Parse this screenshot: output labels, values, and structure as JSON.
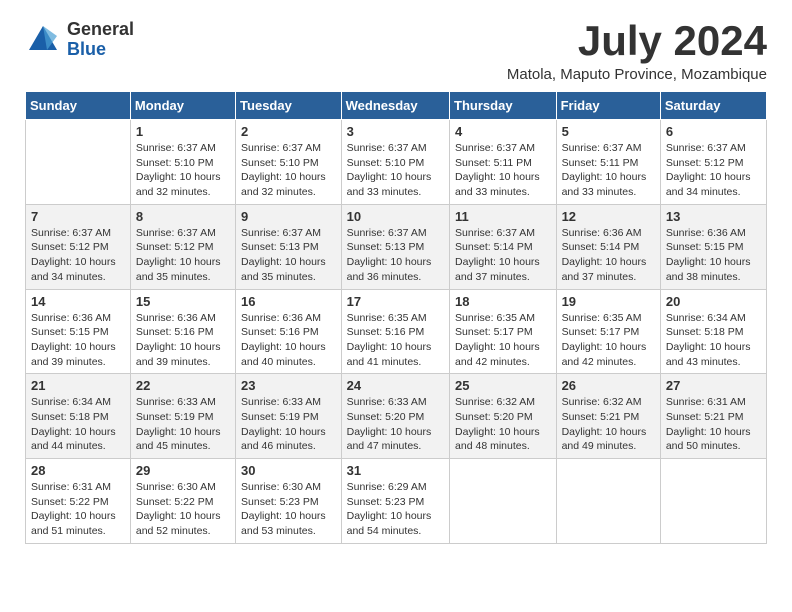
{
  "header": {
    "logo_general": "General",
    "logo_blue": "Blue",
    "month_title": "July 2024",
    "subtitle": "Matola, Maputo Province, Mozambique"
  },
  "days_of_week": [
    "Sunday",
    "Monday",
    "Tuesday",
    "Wednesday",
    "Thursday",
    "Friday",
    "Saturday"
  ],
  "weeks": [
    [
      {
        "day": "",
        "sunrise": "",
        "sunset": "",
        "daylight": ""
      },
      {
        "day": "1",
        "sunrise": "Sunrise: 6:37 AM",
        "sunset": "Sunset: 5:10 PM",
        "daylight": "Daylight: 10 hours and 32 minutes."
      },
      {
        "day": "2",
        "sunrise": "Sunrise: 6:37 AM",
        "sunset": "Sunset: 5:10 PM",
        "daylight": "Daylight: 10 hours and 32 minutes."
      },
      {
        "day": "3",
        "sunrise": "Sunrise: 6:37 AM",
        "sunset": "Sunset: 5:10 PM",
        "daylight": "Daylight: 10 hours and 33 minutes."
      },
      {
        "day": "4",
        "sunrise": "Sunrise: 6:37 AM",
        "sunset": "Sunset: 5:11 PM",
        "daylight": "Daylight: 10 hours and 33 minutes."
      },
      {
        "day": "5",
        "sunrise": "Sunrise: 6:37 AM",
        "sunset": "Sunset: 5:11 PM",
        "daylight": "Daylight: 10 hours and 33 minutes."
      },
      {
        "day": "6",
        "sunrise": "Sunrise: 6:37 AM",
        "sunset": "Sunset: 5:12 PM",
        "daylight": "Daylight: 10 hours and 34 minutes."
      }
    ],
    [
      {
        "day": "7",
        "sunrise": "Sunrise: 6:37 AM",
        "sunset": "Sunset: 5:12 PM",
        "daylight": "Daylight: 10 hours and 34 minutes."
      },
      {
        "day": "8",
        "sunrise": "Sunrise: 6:37 AM",
        "sunset": "Sunset: 5:12 PM",
        "daylight": "Daylight: 10 hours and 35 minutes."
      },
      {
        "day": "9",
        "sunrise": "Sunrise: 6:37 AM",
        "sunset": "Sunset: 5:13 PM",
        "daylight": "Daylight: 10 hours and 35 minutes."
      },
      {
        "day": "10",
        "sunrise": "Sunrise: 6:37 AM",
        "sunset": "Sunset: 5:13 PM",
        "daylight": "Daylight: 10 hours and 36 minutes."
      },
      {
        "day": "11",
        "sunrise": "Sunrise: 6:37 AM",
        "sunset": "Sunset: 5:14 PM",
        "daylight": "Daylight: 10 hours and 37 minutes."
      },
      {
        "day": "12",
        "sunrise": "Sunrise: 6:36 AM",
        "sunset": "Sunset: 5:14 PM",
        "daylight": "Daylight: 10 hours and 37 minutes."
      },
      {
        "day": "13",
        "sunrise": "Sunrise: 6:36 AM",
        "sunset": "Sunset: 5:15 PM",
        "daylight": "Daylight: 10 hours and 38 minutes."
      }
    ],
    [
      {
        "day": "14",
        "sunrise": "Sunrise: 6:36 AM",
        "sunset": "Sunset: 5:15 PM",
        "daylight": "Daylight: 10 hours and 39 minutes."
      },
      {
        "day": "15",
        "sunrise": "Sunrise: 6:36 AM",
        "sunset": "Sunset: 5:16 PM",
        "daylight": "Daylight: 10 hours and 39 minutes."
      },
      {
        "day": "16",
        "sunrise": "Sunrise: 6:36 AM",
        "sunset": "Sunset: 5:16 PM",
        "daylight": "Daylight: 10 hours and 40 minutes."
      },
      {
        "day": "17",
        "sunrise": "Sunrise: 6:35 AM",
        "sunset": "Sunset: 5:16 PM",
        "daylight": "Daylight: 10 hours and 41 minutes."
      },
      {
        "day": "18",
        "sunrise": "Sunrise: 6:35 AM",
        "sunset": "Sunset: 5:17 PM",
        "daylight": "Daylight: 10 hours and 42 minutes."
      },
      {
        "day": "19",
        "sunrise": "Sunrise: 6:35 AM",
        "sunset": "Sunset: 5:17 PM",
        "daylight": "Daylight: 10 hours and 42 minutes."
      },
      {
        "day": "20",
        "sunrise": "Sunrise: 6:34 AM",
        "sunset": "Sunset: 5:18 PM",
        "daylight": "Daylight: 10 hours and 43 minutes."
      }
    ],
    [
      {
        "day": "21",
        "sunrise": "Sunrise: 6:34 AM",
        "sunset": "Sunset: 5:18 PM",
        "daylight": "Daylight: 10 hours and 44 minutes."
      },
      {
        "day": "22",
        "sunrise": "Sunrise: 6:33 AM",
        "sunset": "Sunset: 5:19 PM",
        "daylight": "Daylight: 10 hours and 45 minutes."
      },
      {
        "day": "23",
        "sunrise": "Sunrise: 6:33 AM",
        "sunset": "Sunset: 5:19 PM",
        "daylight": "Daylight: 10 hours and 46 minutes."
      },
      {
        "day": "24",
        "sunrise": "Sunrise: 6:33 AM",
        "sunset": "Sunset: 5:20 PM",
        "daylight": "Daylight: 10 hours and 47 minutes."
      },
      {
        "day": "25",
        "sunrise": "Sunrise: 6:32 AM",
        "sunset": "Sunset: 5:20 PM",
        "daylight": "Daylight: 10 hours and 48 minutes."
      },
      {
        "day": "26",
        "sunrise": "Sunrise: 6:32 AM",
        "sunset": "Sunset: 5:21 PM",
        "daylight": "Daylight: 10 hours and 49 minutes."
      },
      {
        "day": "27",
        "sunrise": "Sunrise: 6:31 AM",
        "sunset": "Sunset: 5:21 PM",
        "daylight": "Daylight: 10 hours and 50 minutes."
      }
    ],
    [
      {
        "day": "28",
        "sunrise": "Sunrise: 6:31 AM",
        "sunset": "Sunset: 5:22 PM",
        "daylight": "Daylight: 10 hours and 51 minutes."
      },
      {
        "day": "29",
        "sunrise": "Sunrise: 6:30 AM",
        "sunset": "Sunset: 5:22 PM",
        "daylight": "Daylight: 10 hours and 52 minutes."
      },
      {
        "day": "30",
        "sunrise": "Sunrise: 6:30 AM",
        "sunset": "Sunset: 5:23 PM",
        "daylight": "Daylight: 10 hours and 53 minutes."
      },
      {
        "day": "31",
        "sunrise": "Sunrise: 6:29 AM",
        "sunset": "Sunset: 5:23 PM",
        "daylight": "Daylight: 10 hours and 54 minutes."
      },
      {
        "day": "",
        "sunrise": "",
        "sunset": "",
        "daylight": ""
      },
      {
        "day": "",
        "sunrise": "",
        "sunset": "",
        "daylight": ""
      },
      {
        "day": "",
        "sunrise": "",
        "sunset": "",
        "daylight": ""
      }
    ]
  ]
}
